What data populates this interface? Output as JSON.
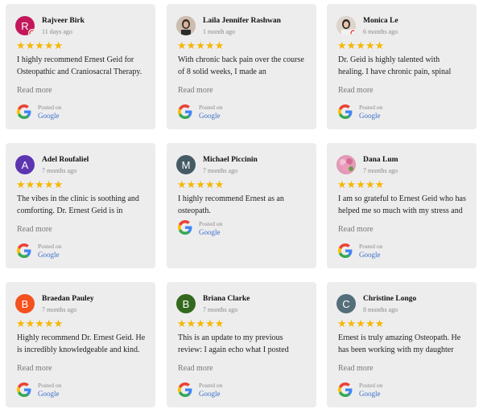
{
  "reviews": [
    {
      "name": "Rajveer Birk",
      "time": "11 days ago",
      "avatar_letter": "R",
      "avatar_color": "#c2185b",
      "stars": "★★★★★",
      "text": "I highly recommend Ernest Geid for Osteopathic and Craniosacral Therapy. I have worked with Ernest for the past",
      "read_more": "Read more",
      "posted": "Posted on",
      "source": "Google"
    },
    {
      "name": "Laila Jennifer Rashwan",
      "time": "1 month ago",
      "avatar_letter": "",
      "avatar_color": "#d9d2c8",
      "stars": "★★★★★",
      "text": "With chronic back pain over the course of 8 solid weeks, I made an appointment with Dr. Geid not feeling",
      "read_more": "Read more",
      "posted": "Posted on",
      "source": "Google"
    },
    {
      "name": "Monica Le",
      "time": "6 months ago",
      "avatar_letter": "",
      "avatar_color": "#d9d2c8",
      "stars": "★★★★★",
      "text": "Dr. Geid is highly talented with healing. I have chronic pain, spinal fusion, and craniosacral therapy helps",
      "read_more": "Read more",
      "posted": "Posted on",
      "source": "Google"
    },
    {
      "name": "Adel Roufaliel",
      "time": "7 months ago",
      "avatar_letter": "A",
      "avatar_color": "#5e35b1",
      "stars": "★★★★★",
      "text": "The vibes in the clinic is soothing and comforting. Dr. Ernest Geid is in addition to being scientifically very",
      "read_more": "Read more",
      "posted": "Posted on",
      "source": "Google"
    },
    {
      "name": "Michael Piccinin",
      "time": "7 months ago",
      "avatar_letter": "M",
      "avatar_color": "#455a64",
      "stars": "★★★★★",
      "text": "I highly recommend Ernest as an osteopath.",
      "read_more": "",
      "posted": "Posted on",
      "source": "Google"
    },
    {
      "name": "Dana Lum",
      "time": "7 months ago",
      "avatar_letter": "",
      "avatar_color": "#e8a5c0",
      "stars": "★★★★★",
      "text": "I am so grateful to Ernest Geid who has helped me so much with my stress and resulting TMJ issues. I feel more calm,",
      "read_more": "Read more",
      "posted": "Posted on",
      "source": "Google"
    },
    {
      "name": "Braedan Pauley",
      "time": "7 months ago",
      "avatar_letter": "B",
      "avatar_color": "#f4511e",
      "stars": "★★★★★",
      "text": "Highly recommend Dr. Ernest Geid. He is incredibly knowledgeable and kind. Ernest genuinely cares about his",
      "read_more": "Read more",
      "posted": "Posted on",
      "source": "Google"
    },
    {
      "name": "Briana Clarke",
      "time": "7 months ago",
      "avatar_letter": "B",
      "avatar_color": "#33691e",
      "stars": "★★★★★",
      "text": "This is an update to my previous review: I again echo what I posted before about the amazing changes that",
      "read_more": "Read more",
      "posted": "Posted on",
      "source": "Google"
    },
    {
      "name": "Christine Longo",
      "time": "8 months ago",
      "avatar_letter": "C",
      "avatar_color": "#546e7a",
      "stars": "★★★★★",
      "text": "Ernest is truly amazing Osteopath. He has been working with my daughter and each treatment she comes out",
      "read_more": "Read more",
      "posted": "Posted on",
      "source": "Google"
    }
  ]
}
